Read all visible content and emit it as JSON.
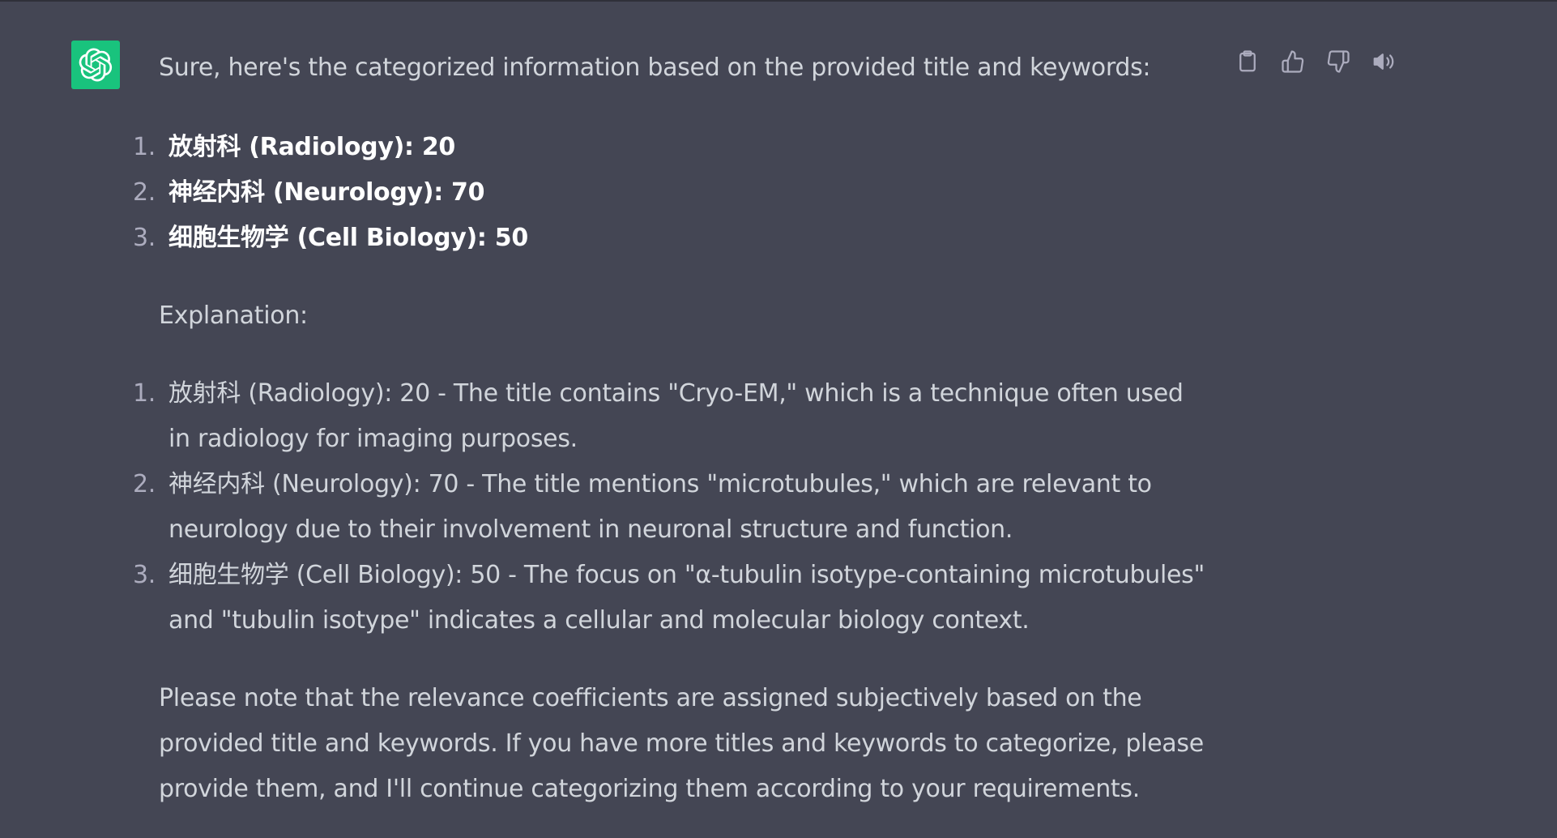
{
  "assistant": {
    "avatar_icon": "openai-logo-icon",
    "avatar_color": "#19c37d"
  },
  "message": {
    "intro": "Sure, here's the categorized information based on the provided title and keywords:",
    "categories": [
      {
        "number": "1.",
        "text": "放射科 (Radiology): 20"
      },
      {
        "number": "2.",
        "text": "神经内科 (Neurology): 70"
      },
      {
        "number": "3.",
        "text": "细胞生物学 (Cell Biology): 50"
      }
    ],
    "explanation_label": "Explanation:",
    "explanations": [
      {
        "number": "1.",
        "text": "放射科 (Radiology): 20 - The title contains \"Cryo-EM,\" which is a technique often used in radiology for imaging purposes."
      },
      {
        "number": "2.",
        "text": "神经内科 (Neurology): 70 - The title mentions \"microtubules,\" which are relevant to neurology due to their involvement in neuronal structure and function."
      },
      {
        "number": "3.",
        "text": "细胞生物学 (Cell Biology): 50 - The focus on \"α-tubulin isotype-containing microtubules\" and \"tubulin isotype\" indicates a cellular and molecular biology context."
      }
    ],
    "note": "Please note that the relevance coefficients are assigned subjectively based on the provided title and keywords. If you have more titles and keywords to categorize, please provide them, and I'll continue categorizing them according to your requirements."
  },
  "actions": {
    "icons": [
      "clipboard-icon",
      "thumbs-up-icon",
      "thumbs-down-icon",
      "speaker-icon"
    ]
  },
  "colors": {
    "background": "#444654",
    "text": "#d1d5db",
    "bold_text": "#ffffff",
    "icon": "#acacbe"
  }
}
